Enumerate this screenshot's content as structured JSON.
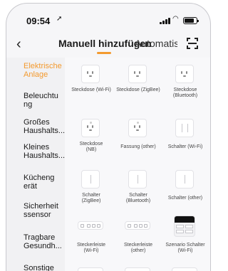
{
  "status_bar": {
    "time": "09:54",
    "location_glyph": "➚",
    "wifi_glyph": "◠"
  },
  "header": {
    "back_glyph": "‹",
    "tab_manual": "Manuell hinzufügen",
    "tab_auto": "Automatis",
    "scan_icon": "scan-icon"
  },
  "sidebar": {
    "items": [
      {
        "label": "Elektrische Anlage",
        "active": true
      },
      {
        "label": "Beleuchtung"
      },
      {
        "label": "Großes Haushalts..."
      },
      {
        "label": "Kleines Haushalts..."
      },
      {
        "label": "Küchengerät"
      },
      {
        "label": "Sicherheitssensor"
      },
      {
        "label": "Tragbare Gesundh..."
      },
      {
        "label": "Sonstige"
      }
    ]
  },
  "devices": [
    {
      "label": "Steckdose (Wi-Fi)",
      "icon": "socket-icon"
    },
    {
      "label": "Steckdose (ZigBee)",
      "icon": "socket-icon"
    },
    {
      "label": "Steckdose (Bluetooth)",
      "icon": "socket-icon"
    },
    {
      "label": "Steckdose (NB)",
      "icon": "socket-icon"
    },
    {
      "label": "Fassung (other)",
      "icon": "socket-icon"
    },
    {
      "label": "Schalter (Wi-Fi)",
      "icon": "switch-icon"
    },
    {
      "label": "Schalter (ZigBee)",
      "icon": "switch-icon"
    },
    {
      "label": "Schalter (Bluetooth)",
      "icon": "switch-icon"
    },
    {
      "label": "Schalter (other)",
      "icon": "switch-icon"
    },
    {
      "label": "Steckerleiste (Wi-Fi)",
      "icon": "power-strip-icon"
    },
    {
      "label": "Steckerleiste (other)",
      "icon": "power-strip-icon"
    },
    {
      "label": "Szenario Schalter (Wi-Fi)",
      "icon": "scene-switch-icon"
    }
  ],
  "colors": {
    "accent": "#f39a2f",
    "text": "#1a1a1a",
    "sidebar_bg": "#f1f1f3"
  }
}
